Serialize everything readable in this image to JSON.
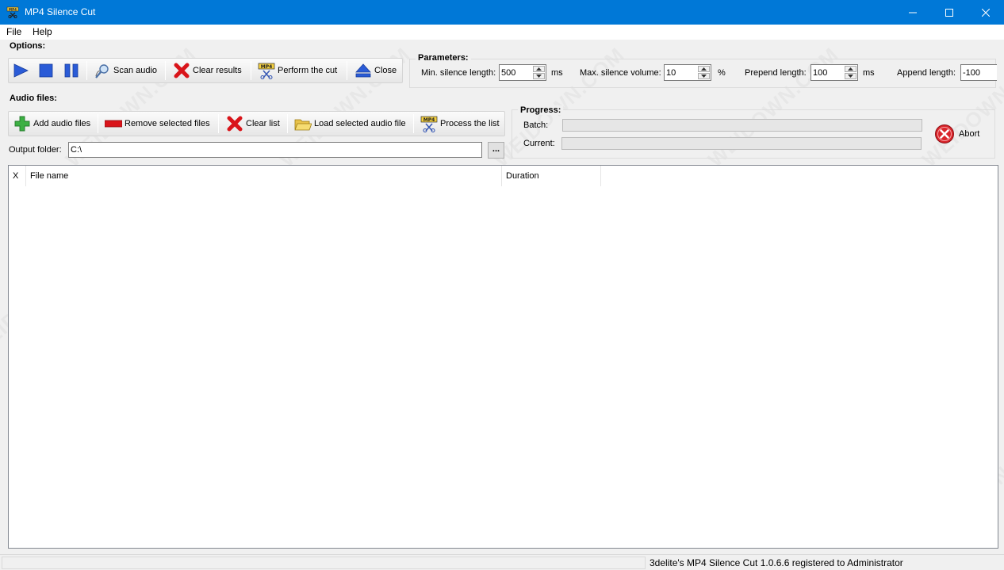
{
  "window": {
    "title": "MP4 Silence Cut"
  },
  "menu": {
    "items": [
      "File",
      "Help"
    ]
  },
  "options": {
    "label": "Options:",
    "buttons": {
      "scan": "Scan audio",
      "clear": "Clear results",
      "cut": "Perform the cut",
      "close": "Close"
    }
  },
  "parameters": {
    "label": "Parameters:",
    "min_silence": {
      "label": "Min. silence length:",
      "value": "500",
      "unit": "ms"
    },
    "max_volume": {
      "label": "Max. silence volume:",
      "value": "10",
      "unit": "%"
    },
    "prepend": {
      "label": "Prepend length:",
      "value": "100",
      "unit": "ms"
    },
    "append": {
      "label": "Append length:",
      "value": "-100"
    }
  },
  "audio_files": {
    "label": "Audio files:",
    "buttons": {
      "add": "Add audio files",
      "remove": "Remove selected files",
      "clear": "Clear list",
      "load": "Load selected audio file",
      "process": "Process the list"
    },
    "output_label": "Output folder:",
    "output_value": "C:\\",
    "browse": "..."
  },
  "progress": {
    "label": "Progress:",
    "batch_label": "Batch:",
    "current_label": "Current:",
    "batch_fraction": 0,
    "current_fraction": 0,
    "abort": "Abort"
  },
  "file_list": {
    "columns": [
      "X",
      "File name",
      "Duration"
    ],
    "rows": []
  },
  "watermark": "WEIDOWN.COM",
  "status": {
    "text": "3delite's MP4 Silence Cut 1.0.6.6 registered to Administrator"
  },
  "colors": {
    "titlebar": "#0078d7",
    "accent_play": "#2a5bd7",
    "progress_fill": "#06b025"
  }
}
